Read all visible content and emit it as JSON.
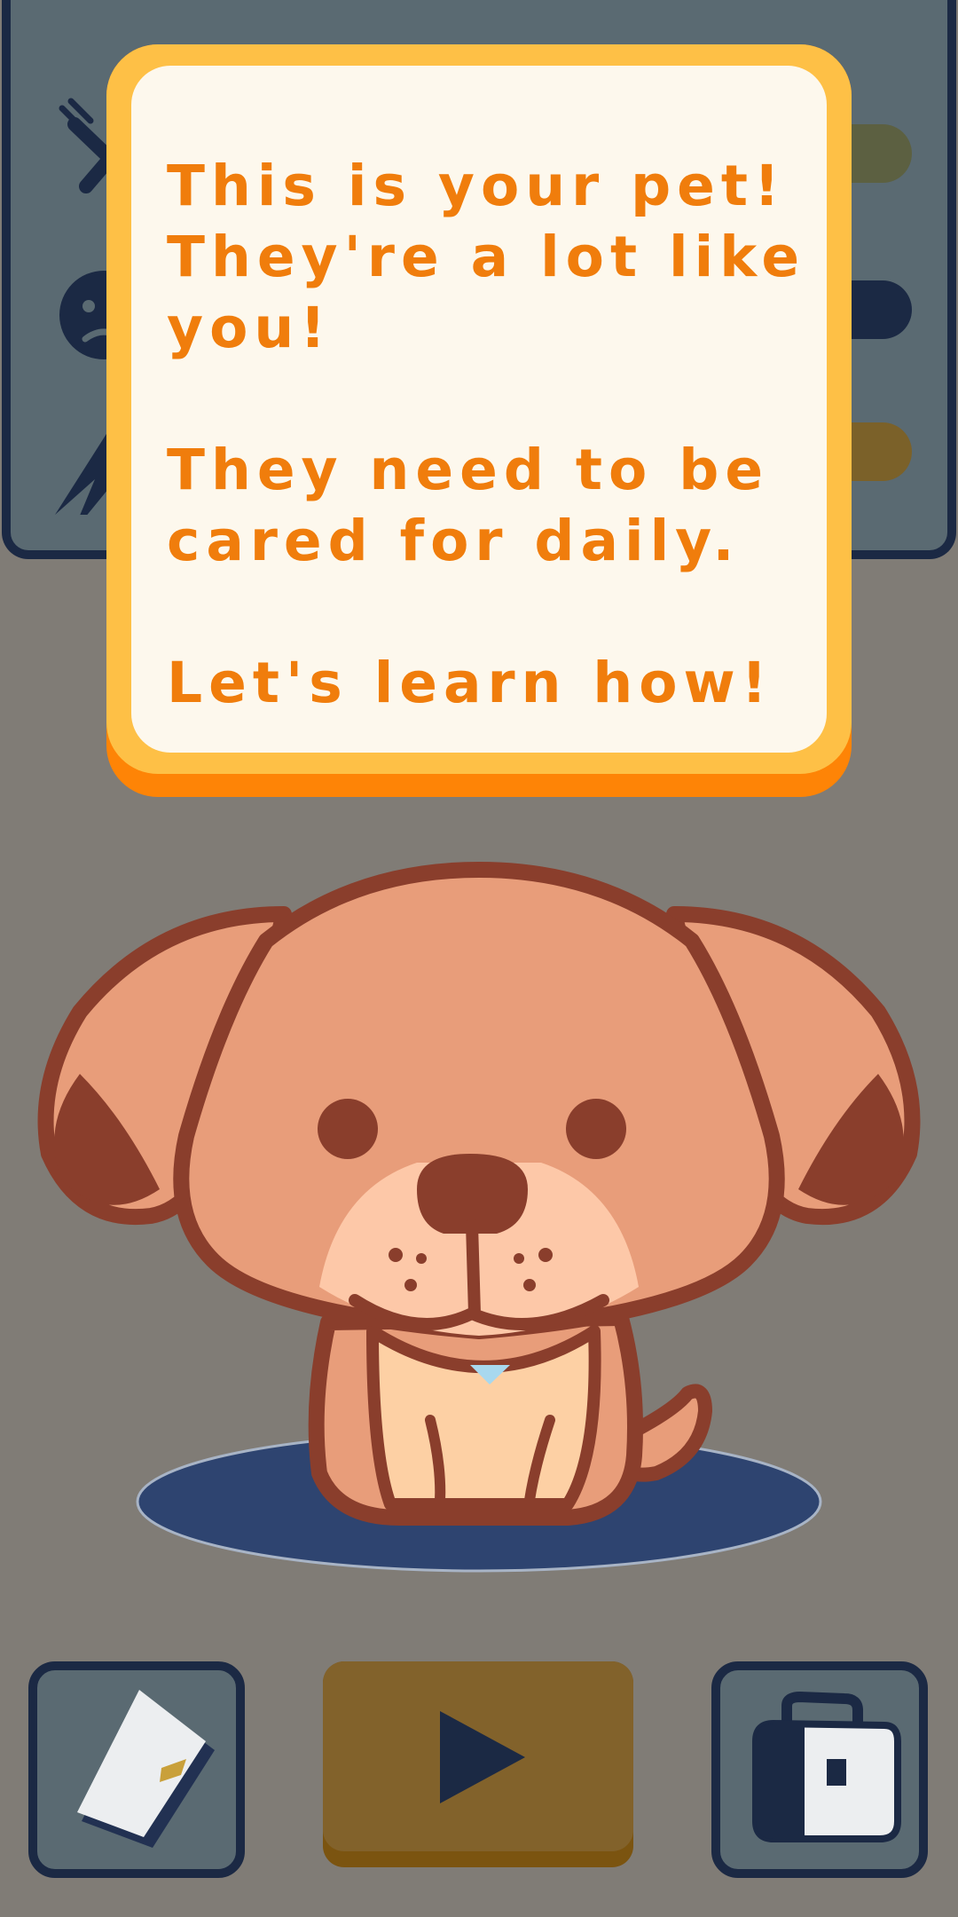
{
  "dialog": {
    "message": "This is your pet!\nThey're a lot like\nyou!\n\nThey need to be\ncared for daily.\n\nLet's learn how!"
  },
  "stats": [
    {
      "icon": "fork-knife-icon",
      "bar_color": "#5c6041"
    },
    {
      "icon": "sad-face-icon",
      "bar_color": "#1b2944"
    },
    {
      "icon": "lightning-icon",
      "bar_color": "#7b6129"
    }
  ],
  "buttons": {
    "journal": {
      "icon": "journal-icon"
    },
    "play": {
      "icon": "play-icon"
    },
    "bag": {
      "icon": "bag-icon"
    }
  },
  "pet": {
    "type": "puppy",
    "shadow_color": "#2e4470"
  },
  "colors": {
    "background": "#807c76",
    "dialog_border": "#fec046",
    "dialog_fill": "#fdf8ed",
    "dialog_text": "#f07d0c",
    "panel_border": "#1b2944"
  }
}
